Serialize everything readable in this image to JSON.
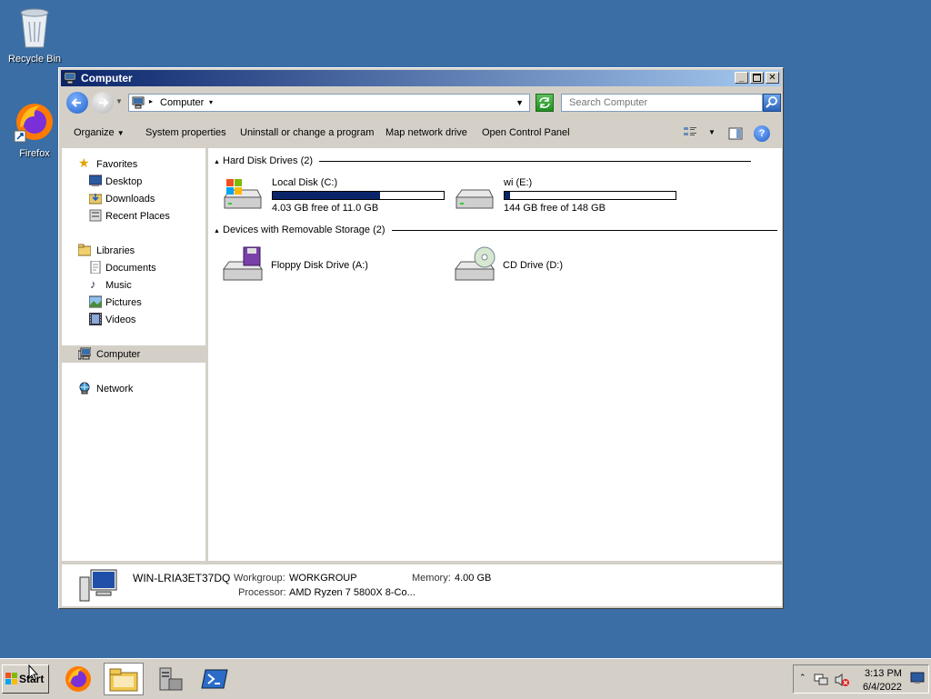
{
  "desktop": {
    "icons": [
      {
        "label": "Recycle Bin",
        "icon": "recycle-bin-icon"
      },
      {
        "label": "Firefox",
        "icon": "firefox-icon"
      }
    ]
  },
  "window": {
    "title": "Computer",
    "address": {
      "path": "Computer"
    },
    "search": {
      "placeholder": "Search Computer"
    },
    "toolbar": {
      "organize": "Organize",
      "system_properties": "System properties",
      "uninstall": "Uninstall or change a program",
      "map_drive": "Map network drive",
      "control_panel": "Open Control Panel"
    },
    "nav": {
      "favorites": "Favorites",
      "desktop": "Desktop",
      "downloads": "Downloads",
      "recent": "Recent Places",
      "libraries": "Libraries",
      "documents": "Documents",
      "music": "Music",
      "pictures": "Pictures",
      "videos": "Videos",
      "computer": "Computer",
      "network": "Network"
    },
    "groups": {
      "hdd": "Hard Disk Drives (2)",
      "removable": "Devices with Removable Storage (2)"
    },
    "drives": {
      "c": {
        "name": "Local Disk (C:)",
        "free": "4.03 GB free of 11.0 GB",
        "used_fraction": 0.63
      },
      "e": {
        "name": "wi (E:)",
        "free": "144 GB free of 148 GB",
        "used_fraction": 0.03
      },
      "a": {
        "name": "Floppy Disk Drive (A:)"
      },
      "d": {
        "name": "CD Drive (D:)"
      }
    },
    "details": {
      "computer_name": "WIN-LRIA3ET37DQ",
      "workgroup_label": "Workgroup:",
      "workgroup": "WORKGROUP",
      "memory_label": "Memory:",
      "memory": "4.00 GB",
      "processor_label": "Processor:",
      "processor": "AMD Ryzen 7 5800X 8-Co..."
    }
  },
  "taskbar": {
    "start": "Start",
    "clock_time": "3:13 PM",
    "clock_date": "6/4/2022"
  }
}
